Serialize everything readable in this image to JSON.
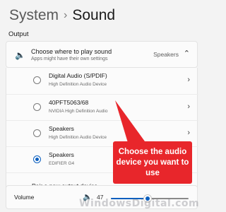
{
  "header": {
    "crumb": "System",
    "separator": "›",
    "page": "Sound"
  },
  "output": {
    "section_label": "Output",
    "choose": {
      "title": "Choose where to play sound",
      "subtitle": "Apps might have their own settings",
      "value": "Speakers",
      "icon": "speaker-icon",
      "expand_icon": "chevron-up-icon"
    },
    "devices": [
      {
        "name": "Digital Audio (S/PDIF)",
        "sub": "High Definition Audio Device",
        "selected": false
      },
      {
        "name": "40PFT5063/68",
        "sub": "NVIDIA High Definition Audio",
        "selected": false
      },
      {
        "name": "Speakers",
        "sub": "High Definition Audio Device",
        "selected": false
      },
      {
        "name": "Speakers",
        "sub": "EDIFIER G4",
        "selected": true
      }
    ],
    "pair_label": "Pair a new output device"
  },
  "volume": {
    "label": "Volume",
    "value": "47",
    "level": 0.47,
    "icon": "speaker-icon"
  },
  "callout": {
    "text": "Choose the audio device you want to use",
    "color": "#e8262b"
  },
  "watermark": "WindowsDigital.com",
  "accent": "#0b5fbf"
}
